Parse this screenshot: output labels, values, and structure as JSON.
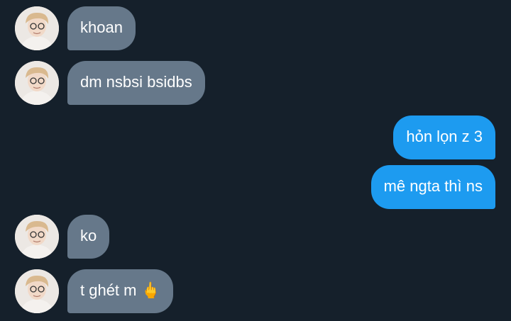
{
  "messages": [
    {
      "direction": "in",
      "text": "khoan"
    },
    {
      "direction": "in",
      "text": "dm nsbsi bsidbs"
    },
    {
      "direction": "out",
      "text": "hỏn lọn z 3"
    },
    {
      "direction": "out",
      "text": "mê ngta thì ns"
    },
    {
      "direction": "in",
      "text": "ko"
    },
    {
      "direction": "in",
      "text": "t ghét m 🖕"
    }
  ],
  "colors": {
    "background": "#15202b",
    "incoming_bubble": "#66788a",
    "outgoing_bubble": "#1d9bf0",
    "text": "#ffffff"
  }
}
